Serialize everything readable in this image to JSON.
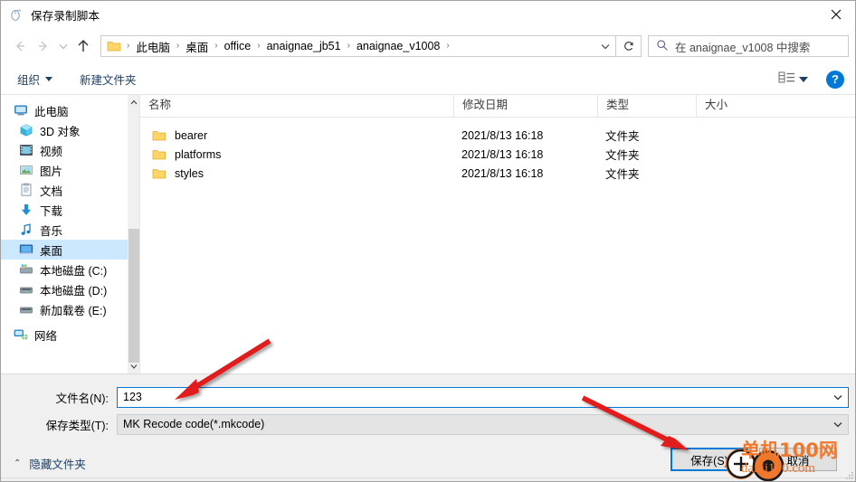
{
  "window": {
    "title": "保存录制脚本",
    "title_icon": "mouse-icon",
    "close_label": "✕"
  },
  "nav": {
    "back_icon": "arrow-left-icon",
    "forward_icon": "arrow-right-icon",
    "recent_icon": "chevron-down-icon",
    "up_icon": "arrow-up-icon",
    "refresh_icon": "refresh-icon",
    "breadcrumb": [
      "此电脑",
      "桌面",
      "office",
      "anaignae_jb51",
      "anaignae_v1008"
    ],
    "breadcrumb_separator": "›",
    "dropdown_icon": "chevron-down-icon"
  },
  "search": {
    "icon": "search-icon",
    "placeholder": "在 anaignae_v1008 中搜索"
  },
  "toolbar": {
    "organize_label": "组织",
    "new_folder_label": "新建文件夹",
    "view_icon": "list-view-icon",
    "help_label": "?"
  },
  "sidebar": {
    "items": [
      {
        "label": "此电脑",
        "icon": "computer-icon",
        "level": 0,
        "selected": false
      },
      {
        "label": "3D 对象",
        "icon": "3d-objects-icon",
        "level": 1,
        "selected": false
      },
      {
        "label": "视频",
        "icon": "videos-icon",
        "level": 1,
        "selected": false
      },
      {
        "label": "图片",
        "icon": "pictures-icon",
        "level": 1,
        "selected": false
      },
      {
        "label": "文档",
        "icon": "documents-icon",
        "level": 1,
        "selected": false
      },
      {
        "label": "下载",
        "icon": "downloads-icon",
        "level": 1,
        "selected": false
      },
      {
        "label": "音乐",
        "icon": "music-icon",
        "level": 1,
        "selected": false
      },
      {
        "label": "桌面",
        "icon": "desktop-icon",
        "level": 1,
        "selected": true
      },
      {
        "label": "本地磁盘 (C:)",
        "icon": "system-drive-icon",
        "level": 1,
        "selected": false
      },
      {
        "label": "本地磁盘 (D:)",
        "icon": "drive-icon",
        "level": 1,
        "selected": false
      },
      {
        "label": "新加载卷 (E:)",
        "icon": "drive-icon",
        "level": 1,
        "selected": false
      },
      {
        "label": "网络",
        "icon": "network-icon",
        "level": 0,
        "selected": false
      }
    ]
  },
  "file_list": {
    "columns": [
      "名称",
      "修改日期",
      "类型",
      "大小"
    ],
    "rows": [
      {
        "name": "bearer",
        "date": "2021/8/13 16:18",
        "type": "文件夹",
        "size": "",
        "icon": "folder-icon"
      },
      {
        "name": "platforms",
        "date": "2021/8/13 16:18",
        "type": "文件夹",
        "size": "",
        "icon": "folder-icon"
      },
      {
        "name": "styles",
        "date": "2021/8/13 16:18",
        "type": "文件夹",
        "size": "",
        "icon": "folder-icon"
      }
    ]
  },
  "form": {
    "filename_label": "文件名(N):",
    "filename_value": "123",
    "filetype_label": "保存类型(T):",
    "filetype_value": "MK Recode code(*.mkcode)"
  },
  "footer": {
    "hide_folders_label": "隐藏文件夹",
    "hide_folders_caret": "⌃",
    "save_label": "保存(S)",
    "cancel_label": "取消"
  },
  "watermark": {
    "line1": "单机100网",
    "line2": "danji100.com",
    "color": "#f0782d"
  },
  "annotations": {
    "arrow_color": "#e01b1b",
    "highlight_color": "#0078d7",
    "cursor_icon": "pointer-plus-icon"
  }
}
